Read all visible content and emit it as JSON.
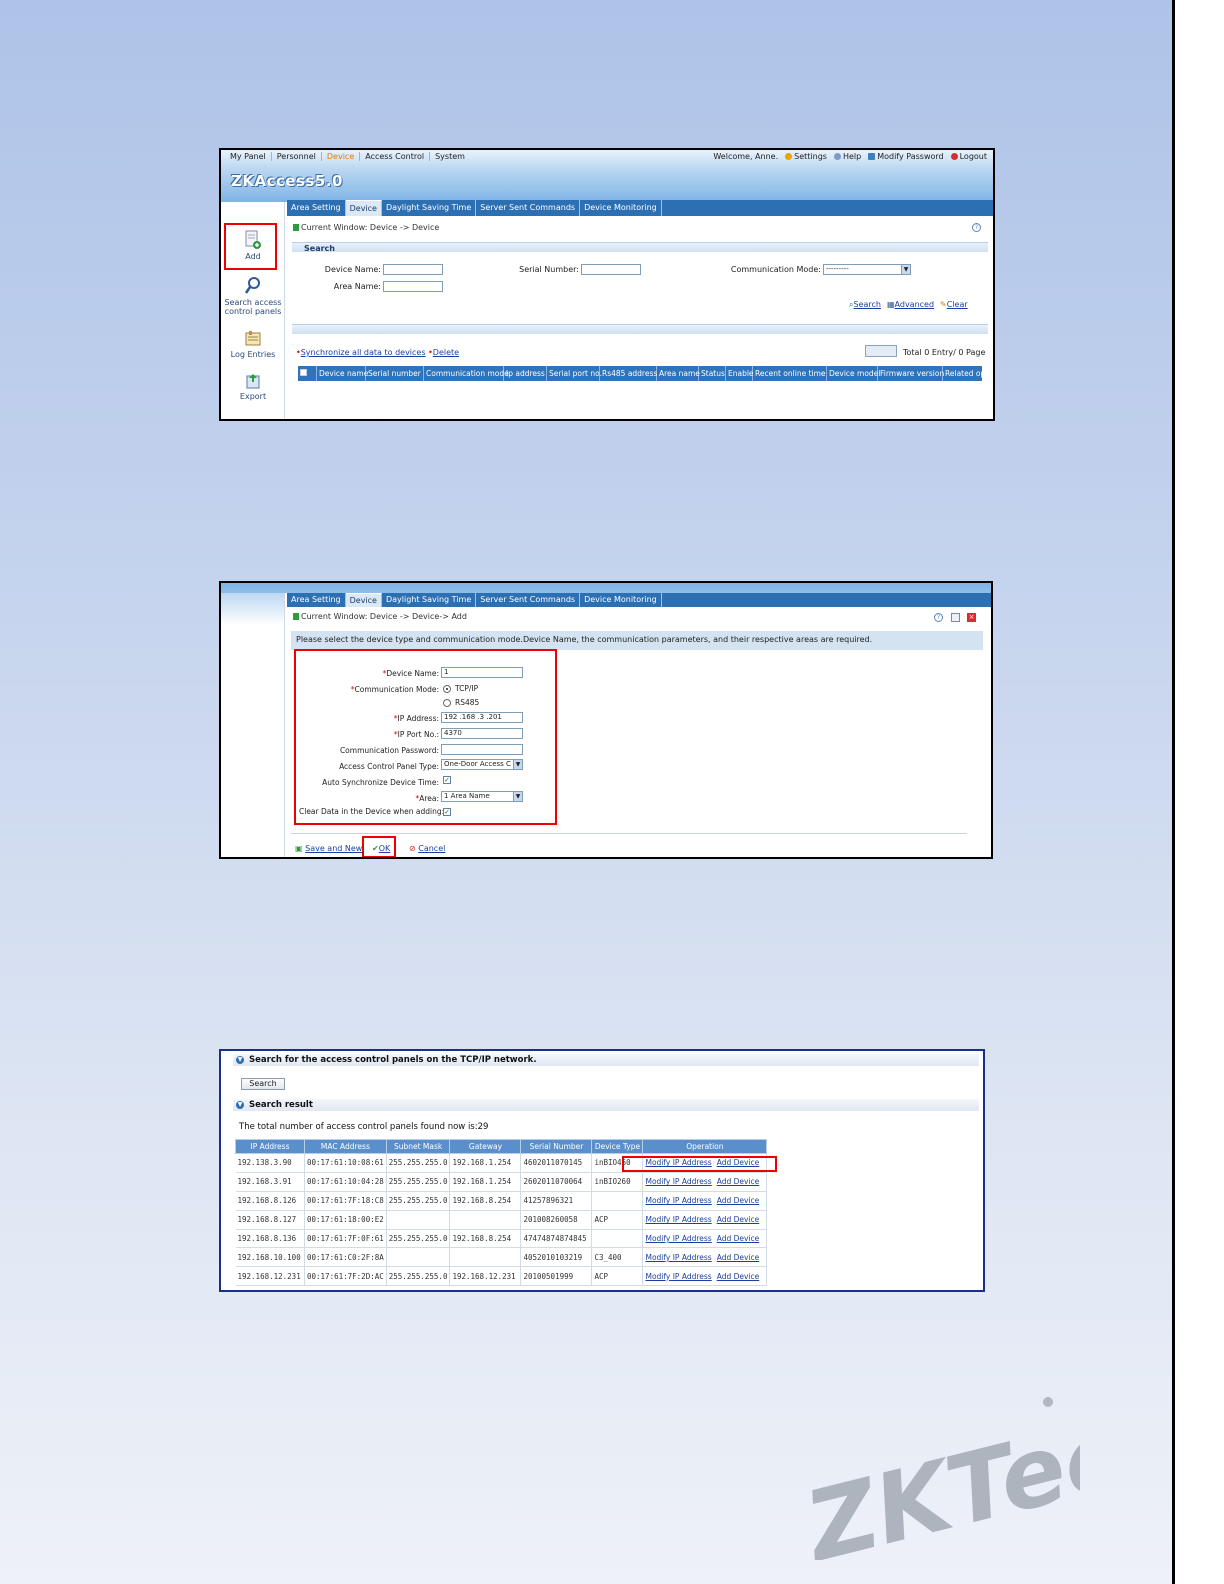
{
  "shot1": {
    "top_menu": [
      "My Panel",
      "Personnel",
      "Device",
      "Access Control",
      "System"
    ],
    "active_menu": "Device",
    "welcome": "Welcome, Anne.",
    "top_links": [
      "Settings",
      "Help",
      "Modify Password",
      "Logout"
    ],
    "logo": "ZKAccess5.0",
    "tabs": [
      "Area Setting",
      "Device",
      "Daylight Saving Time",
      "Server Sent Commands",
      "Device Monitoring"
    ],
    "active_tab": "Device",
    "left_nav": [
      "Add",
      "Search access control panels",
      "Log Entries",
      "Export"
    ],
    "breadcrumb": "Current Window: Device -> Device",
    "search_title": "Search",
    "labels": {
      "device_name": "Device Name:",
      "serial_number": "Serial Number:",
      "comm_mode": "Communication Mode:",
      "area_name": "Area Name:"
    },
    "comm_mode_value": "---------",
    "search_actions": [
      "Search",
      "Advanced",
      "Clear"
    ],
    "sync_link": "Synchronize all data to devices",
    "delete_link": "Delete",
    "total_text": "Total 0 Entry/ 0 Page",
    "columns": [
      "Device name",
      "Serial number",
      "Communication mode",
      "Ip address",
      "Serial port no.",
      "Rs485 address",
      "Area name",
      "Status",
      "Enable",
      "Recent online time",
      "Device model",
      "Firmware version",
      "Related op"
    ]
  },
  "shot2": {
    "tabs": [
      "Area Setting",
      "Device",
      "Daylight Saving Time",
      "Server Sent Commands",
      "Device Monitoring"
    ],
    "active_tab": "Device",
    "breadcrumb": "Current Window: Device -> Device-> Add",
    "info": "Please select the device type and communication mode.Device Name, the communication parameters, and their respective areas are required.",
    "labels": {
      "device_name": "Device Name:",
      "comm_mode": "Communication Mode:",
      "tcpip": "TCP/IP",
      "rs485": "RS485",
      "ip_address": "IP Address:",
      "ip_port": "IP Port No.:",
      "comm_password": "Communication Password:",
      "panel_type": "Access Control Panel Type:",
      "auto_sync": "Auto Synchronize Device Time:",
      "area": "Area:",
      "clear_data": "Clear Data in the Device when adding:"
    },
    "values": {
      "device_name": "1",
      "ip_address": "192 .168 .3 .201",
      "ip_port": "4370",
      "comm_password": "",
      "panel_type": "One-Door Access C",
      "area": "1 Area Name"
    },
    "selected_mode": "TCP/IP",
    "auto_sync_checked": true,
    "clear_data_checked": true,
    "actions": [
      "Save and New",
      "OK",
      "Cancel"
    ]
  },
  "shot3": {
    "section_search": "Search for the access control panels on the TCP/IP network.",
    "search_button": "Search",
    "section_result": "Search result",
    "total_text": "The total number of access control panels found now is:29",
    "columns": [
      "IP Address",
      "MAC Address",
      "Subnet Mask",
      "Gateway",
      "Serial Number",
      "Device Type",
      "Operation"
    ],
    "rows": [
      [
        "192.138.3.90",
        "00:17:61:10:08:61",
        "255.255.255.0",
        "192.168.1.254",
        "4602011070145",
        "inBIO460"
      ],
      [
        "192.168.3.91",
        "00:17:61:10:04:28",
        "255.255.255.0",
        "192.168.1.254",
        "2602011070064",
        "inBIO260"
      ],
      [
        "192.168.8.126",
        "00:17:61:7F:18:C8",
        "255.255.255.0",
        "192.168.8.254",
        "41257896321",
        ""
      ],
      [
        "192.168.8.127",
        "00:17:61:18:00:E2",
        "",
        "",
        "201008260058",
        "ACP"
      ],
      [
        "192.168.8.136",
        "00:17:61:7F:0F:61",
        "255.255.255.0",
        "192.168.8.254",
        "47474874874845",
        ""
      ],
      [
        "192.168.10.100",
        "00:17:61:C0:2F:8A",
        "",
        "",
        "4052010103219",
        "C3_400"
      ],
      [
        "192.168.12.231",
        "00:17:61:7F:2D:AC",
        "255.255.255.0",
        "192.168.12.231",
        "20100501999",
        "ACP"
      ]
    ],
    "op_links": [
      "Modify IP Address",
      "Add Device"
    ]
  },
  "watermark": "ZKTeco"
}
